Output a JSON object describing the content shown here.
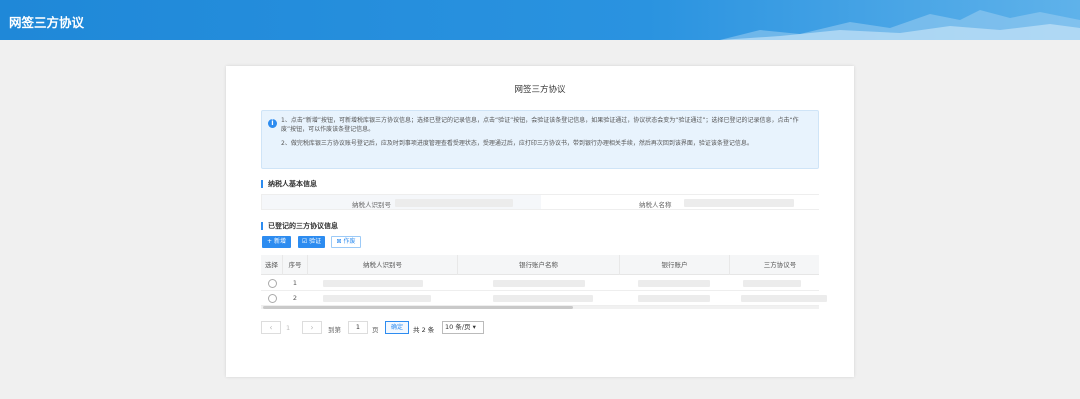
{
  "header": {
    "title": "网签三方协议"
  },
  "card": {
    "title": "网签三方协议",
    "notice": {
      "p1": "1、点击“新增”按钮，可新增税库银三方协议信息；选择已登记的记录信息，点击“验证”按钮，会验证该条登记信息，如果验证通过，协议状态会变为“验证通过”；选择已登记的记录信息，点击“作废”按钮，可以作废该条登记信息。",
      "p2": "2、做完税库银三方协议账号登记后，应及时到事项进度管理查看受理状态，受理通过后，应打印三方协议书，带到银行办理相关手续，然后再次回到该界面，验证该条登记信息。"
    },
    "taxpayer_section": {
      "title": "纳税人基本信息",
      "id_label": "纳税人识别号",
      "name_label": "纳税人名称"
    },
    "agreements_section": {
      "title": "已登记的三方协议信息",
      "buttons": {
        "new": "+ 新增",
        "verify": "☑ 验证",
        "void": "⊠ 作废"
      },
      "columns": [
        "选择",
        "序号",
        "纳税人识别号",
        "银行账户名称",
        "银行账户",
        "三方协议号"
      ],
      "rows": [
        {
          "seq": "1"
        },
        {
          "seq": "2"
        }
      ]
    },
    "pagination": {
      "prev": "‹",
      "page": "1",
      "next": "›",
      "goto_label": "到第",
      "goto_value": "1",
      "page_unit": "页",
      "confirm": "确定",
      "total": "共 2 条",
      "page_size": "10 条/页"
    }
  },
  "colors": {
    "brand": "#1f88d8",
    "accent": "#2d8cf0"
  }
}
